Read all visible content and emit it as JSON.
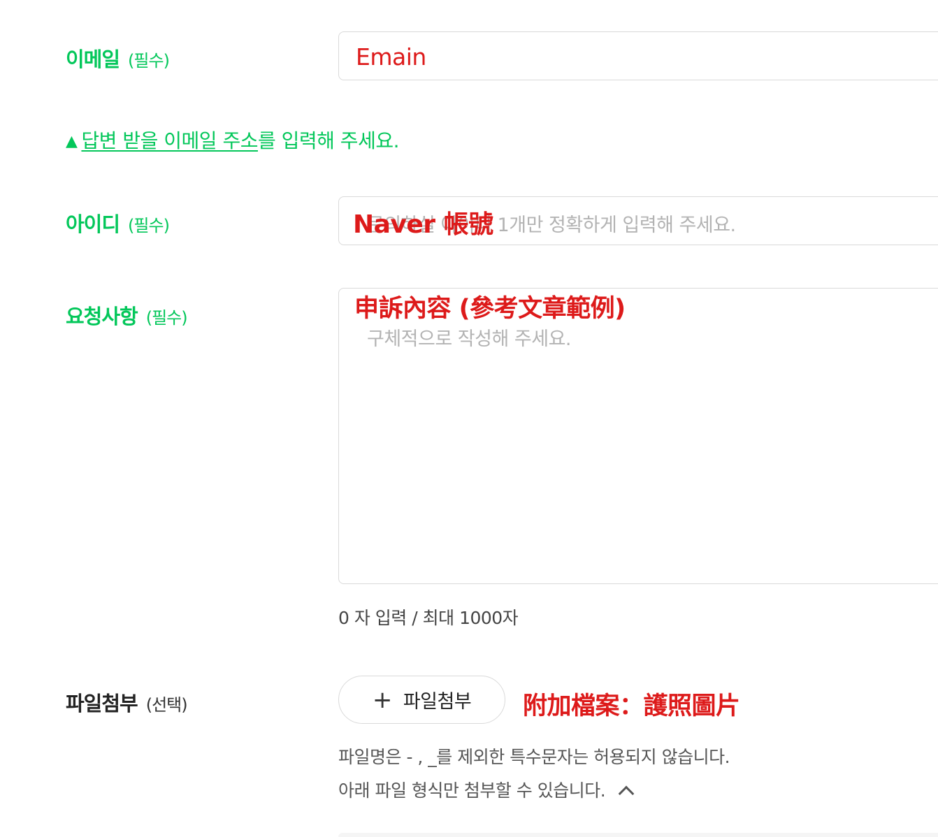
{
  "email": {
    "label": "이메일",
    "required": "(필수)",
    "value": "Emain",
    "hint_triangle": "▲",
    "hint_link": "답변 받을 이메일 주소",
    "hint_rest": "를 입력해 주세요."
  },
  "id": {
    "label": "아이디",
    "required": "(필수)",
    "placeholder": "문의하실 아이디 1개만 정확하게 입력해 주세요.",
    "overlay": "Naver 帳號"
  },
  "request": {
    "label": "요청사항",
    "required": "(필수)",
    "placeholder": "구체적으로 작성해 주세요.",
    "overlay": "申訴內容 (參考文章範例)",
    "counter": "0 자 입력 / 최대 1000자"
  },
  "attachment": {
    "label": "파일첨부",
    "optional": "(선택)",
    "button_label": "파일첨부",
    "button_icon": "plus-icon",
    "overlay": "附加檔案：護照圖片",
    "note1": "파일명은 - , _를 제외한 특수문자는 허용되지 않습니다.",
    "note2": "아래 파일 형식만 첨부할 수 있습니다.",
    "toggle_icon": "chevron-up-icon"
  },
  "colors": {
    "green": "#03c75a",
    "red_annotation": "#dd1a1a",
    "placeholder": "#b3b3b3"
  }
}
